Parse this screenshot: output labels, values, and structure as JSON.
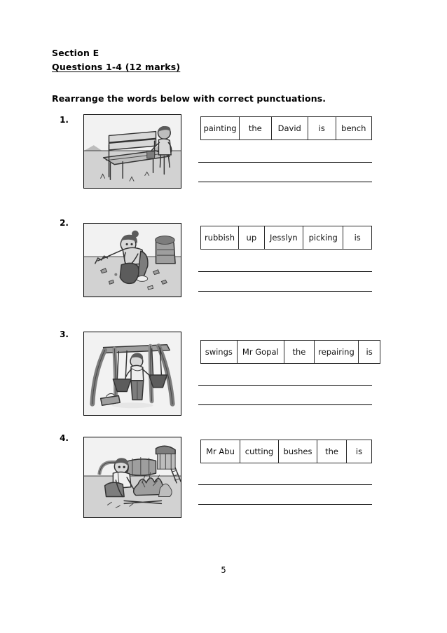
{
  "document": {
    "section_label": "Section E",
    "questions_label": "Questions 1-4 (12 marks)",
    "instruction": "Rearrange the words below with correct punctuations.",
    "page_number": "5"
  },
  "questions": [
    {
      "number": "1.",
      "image_alt": "boy-painting-bench",
      "image_description": "A boy painting a wooden park bench",
      "words": [
        "painting",
        "the",
        "David",
        "is",
        "bench"
      ],
      "answer_lines": [
        "",
        ""
      ]
    },
    {
      "number": "2.",
      "image_alt": "girl-picking-rubbish",
      "image_description": "A girl picking up rubbish into a bag with a rake and bin nearby",
      "words": [
        "rubbish",
        "up",
        "Jesslyn",
        "picking",
        "is"
      ],
      "answer_lines": [
        "",
        ""
      ]
    },
    {
      "number": "3.",
      "image_alt": "man-repairing-swings",
      "image_description": "A man repairing a swing set with a toolbox",
      "words": [
        "swings",
        "Mr Gopal",
        "the",
        "repairing",
        "is"
      ],
      "answer_lines": [
        "",
        ""
      ]
    },
    {
      "number": "4.",
      "image_alt": "man-cutting-bushes",
      "image_description": "A man cutting bushes in front of a playground tunnel slide",
      "words": [
        "Mr Abu",
        "cutting",
        "bushes",
        "the",
        "is"
      ],
      "answer_lines": [
        "",
        ""
      ]
    }
  ],
  "colors": {
    "text": "#000000",
    "rule": "#000000",
    "table_border": "#2b2b2b",
    "page_background": "#ffffff"
  }
}
